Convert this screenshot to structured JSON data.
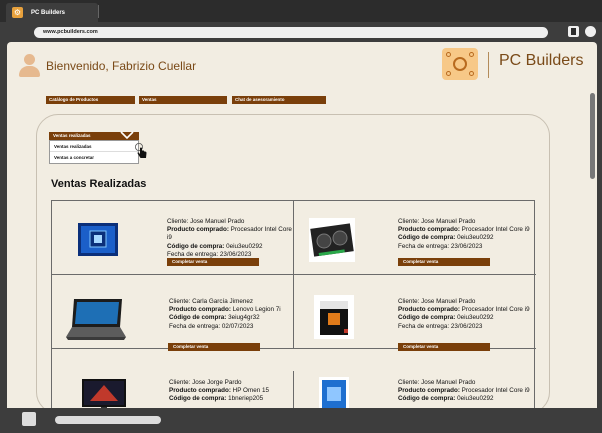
{
  "browser": {
    "tab_title": "PC Builders",
    "url": "www.pcbuilders.com"
  },
  "header": {
    "welcome": "Bienvenido, Fabrizio Cuellar",
    "brand": "PC Builders"
  },
  "nav": {
    "items": [
      {
        "label": "Catálogo de Productos"
      },
      {
        "label": "Ventas"
      },
      {
        "label": "Chat de asesoramiento"
      }
    ]
  },
  "dropdown": {
    "selected": "Ventas realizadas",
    "options": [
      "Ventas realizadas",
      "Ventas a concretar"
    ]
  },
  "section_title": "Ventas Realizadas",
  "labels": {
    "cliente": "Cliente:",
    "producto": "Producto comprado:",
    "codigo": "Código de compra:",
    "fecha": "Fecha de entrega:",
    "button": "Completar venta"
  },
  "sales": [
    {
      "cliente": "Jose Manuel Prado",
      "producto": "Procesador Intel Core i9",
      "codigo": "0eiu3eu0292",
      "fecha": "23/06/2023",
      "image": "intel-core-i9-box"
    },
    {
      "cliente": "Jose Manuel Prado",
      "producto": "Procesador Intel Core i9",
      "codigo": "0eiu3eu0292",
      "fecha": "23/06/2023",
      "image": "graphics-card"
    },
    {
      "cliente": "Carla García Jimenez",
      "producto": "Lenovo Legion 7i",
      "codigo": "3eiug4gr32",
      "fecha": "02/07/2023",
      "image": "laptop"
    },
    {
      "cliente": "Jose Manuel Prado",
      "producto": "Procesador Intel Core i9",
      "codigo": "0eiu3eu0292",
      "fecha": "23/06/2023",
      "image": "amd-ryzen-box"
    },
    {
      "cliente": "Jose Jorge Pardo",
      "producto": "HP Omen 15",
      "codigo": "1bneriep205",
      "fecha": "",
      "image": "monitor"
    },
    {
      "cliente": "Jose Manuel Prado",
      "producto": "Procesador Intel Core i9",
      "codigo": "0eiu3eu0292",
      "fecha": "",
      "image": "intel-box"
    }
  ],
  "colors": {
    "accent": "#7a3f0a",
    "page_bg": "#f2ede2",
    "chrome": "#3d3d3d"
  }
}
